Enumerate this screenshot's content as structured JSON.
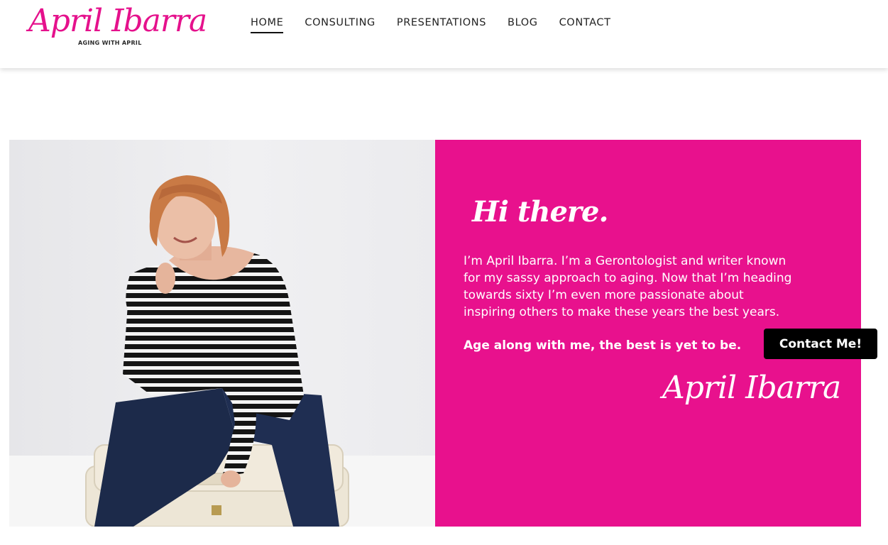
{
  "brand": {
    "logo_script": "April Ibarra",
    "logo_tagline": "AGING WITH APRIL",
    "accent_color": "#e8118d"
  },
  "nav": {
    "items": [
      {
        "label": "HOME",
        "active": true
      },
      {
        "label": "CONSULTING",
        "active": false
      },
      {
        "label": "PRESENTATIONS",
        "active": false
      },
      {
        "label": "BLOG",
        "active": false
      },
      {
        "label": "CONTACT",
        "active": false
      }
    ]
  },
  "hero": {
    "heading": "Hi there.",
    "bio": "I’m April Ibarra. I’m a Gerontologist and writer known for my sassy approach to aging. Now that I’m heading towards sixty I’m even more passionate about inspiring others to make these years the best years.",
    "tagline": "Age along with me, the best is yet to be.",
    "signature": "April Ibarra"
  },
  "cta": {
    "label": "Contact Me!"
  }
}
